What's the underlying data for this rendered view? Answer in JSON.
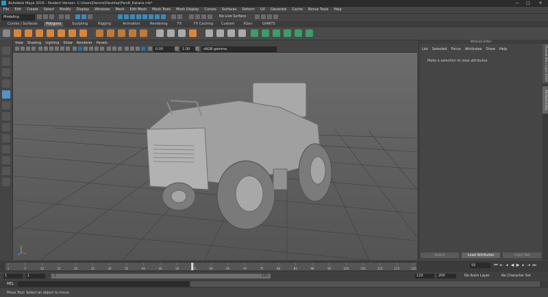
{
  "window": {
    "title": "Autodesk Maya 2016 - Student Version: C:\\Users\\Dennis\\Desktop\\Fendt_Katana.mb*",
    "min": "—",
    "max": "□",
    "close": "✕"
  },
  "menu": [
    "File",
    "Edit",
    "Create",
    "Select",
    "Modify",
    "Display",
    "Windows",
    "Mesh",
    "Edit Mesh",
    "Mesh Tools",
    "Mesh Display",
    "Curves",
    "Surfaces",
    "Deform",
    "UV",
    "Generate",
    "Cache",
    "Bonus Tools",
    "Help"
  ],
  "status_line": {
    "menu_set": "Modeling",
    "live_surface": "No Live Surface"
  },
  "shelf_tabs": [
    {
      "label": "Curves / Surfaces",
      "active": false
    },
    {
      "label": "Polygons",
      "active": true
    },
    {
      "label": "Sculpting",
      "active": false
    },
    {
      "label": "Rigging",
      "active": false
    },
    {
      "label": "Animation",
      "active": false
    },
    {
      "label": "Rendering",
      "active": false
    },
    {
      "label": "FX",
      "active": false
    },
    {
      "label": "FX Caching",
      "active": false
    },
    {
      "label": "Custom",
      "active": false
    },
    {
      "label": "XGen",
      "active": false
    },
    {
      "label": "GIANTS",
      "active": false
    }
  ],
  "panel_menu": [
    "View",
    "Shading",
    "Lighting",
    "Show",
    "Renderer",
    "Panels"
  ],
  "panel_toolbar": {
    "near_value": "0.00",
    "far_value": "1.00",
    "color_space": "sRGB gamma"
  },
  "attribute_editor": {
    "header": "Attribute Editor",
    "menu": [
      "List",
      "Selected",
      "Focus",
      "Attributes",
      "Show",
      "Help"
    ],
    "message": "Make a selection to view attributes",
    "buttons": [
      "Select",
      "Load Attributes",
      "Copy Tab"
    ]
  },
  "side_tabs": [
    "Channel Box / Layer Editor",
    "Attribute Editor"
  ],
  "time_slider": {
    "ticks": [
      "1",
      "5",
      "10",
      "15",
      "20",
      "25",
      "30",
      "35",
      "40",
      "45",
      "50",
      "55",
      "60",
      "65",
      "70",
      "75",
      "80",
      "85",
      "90",
      "95",
      "100",
      "105",
      "110",
      "115",
      "120"
    ],
    "current_frame": "55",
    "current_frame_field": "55"
  },
  "range": {
    "start": "1",
    "range_start": "1",
    "slider_start": "1",
    "slider_end": "120",
    "range_end": "120",
    "end": "200",
    "anim_layer": "No Anim Layer",
    "char_set": "No Character Set"
  },
  "command_line": {
    "label": "MEL"
  },
  "help_line": {
    "text": "Move Tool: Select an object to move."
  },
  "colors": {
    "accent": "#5293c9",
    "viewport_top": "#6c6c6c",
    "viewport_bottom": "#545454",
    "logo": "#1aa2c4"
  }
}
